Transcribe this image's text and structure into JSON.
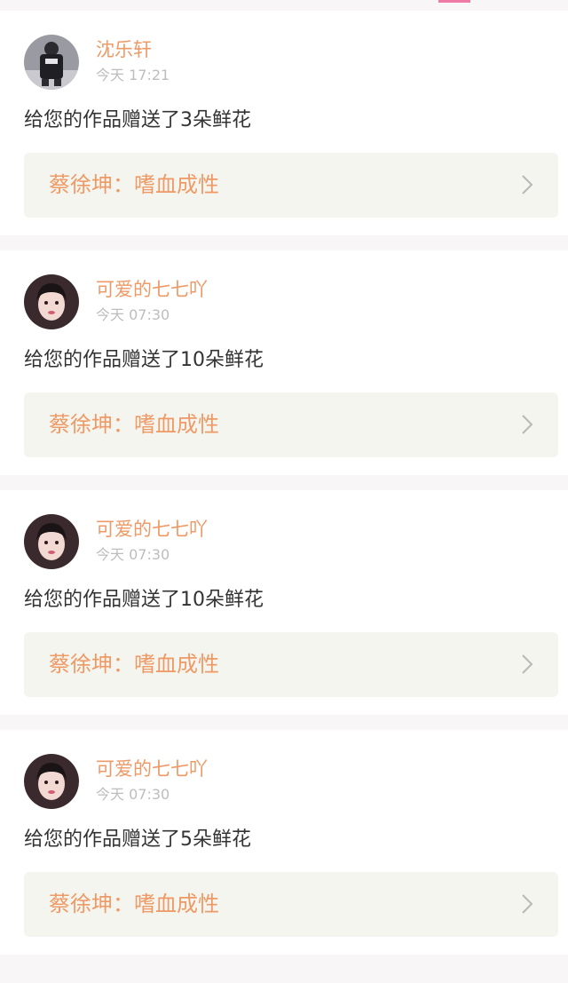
{
  "colors": {
    "accent": "#ee9a66",
    "tab_indicator": "#f07aa6",
    "card_link_bg": "#f5f5ef",
    "page_bg": "#f8f6f6",
    "time_text": "#bdbdbd",
    "body_text": "#333333"
  },
  "notifications": [
    {
      "username": "沈乐轩",
      "time": "今天 17:21",
      "message": "给您的作品赠送了3朵鲜花",
      "work_title": "蔡徐坤：嗜血成性",
      "avatar_icon": "avatar-dark-outfit-icon",
      "chevron_icon": "chevron-right-icon"
    },
    {
      "username": "可爱的七七吖",
      "time": "今天 07:30",
      "message": "给您的作品赠送了10朵鲜花",
      "work_title": "蔡徐坤：嗜血成性",
      "avatar_icon": "avatar-girl-icon",
      "chevron_icon": "chevron-right-icon"
    },
    {
      "username": "可爱的七七吖",
      "time": "今天 07:30",
      "message": "给您的作品赠送了10朵鲜花",
      "work_title": "蔡徐坤：嗜血成性",
      "avatar_icon": "avatar-girl-icon",
      "chevron_icon": "chevron-right-icon"
    },
    {
      "username": "可爱的七七吖",
      "time": "今天 07:30",
      "message": "给您的作品赠送了5朵鲜花",
      "work_title": "蔡徐坤：嗜血成性",
      "avatar_icon": "avatar-girl-icon",
      "chevron_icon": "chevron-right-icon"
    }
  ]
}
